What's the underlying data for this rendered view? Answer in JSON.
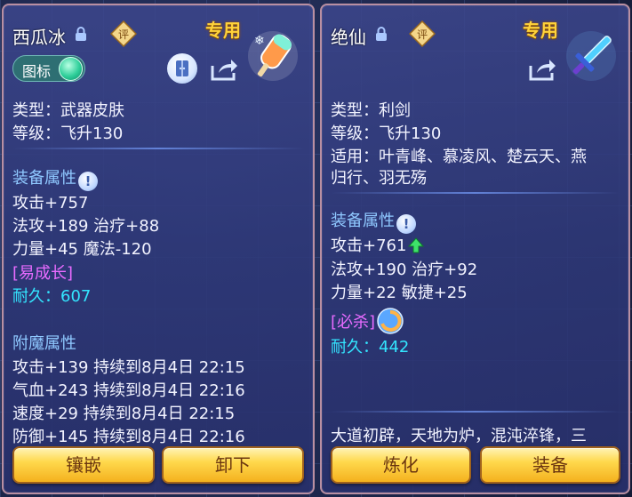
{
  "left_panel": {
    "name": "西瓜冰",
    "special_tag": "专用",
    "icon_toggle_label": "图标",
    "type_line": "类型：武器皮肤",
    "level_line": "等级：飞升130",
    "equip_attr_title": "装备属性",
    "attr_lines": [
      "攻击+757",
      "法攻+189 治疗+88",
      "力量+45 魔法-120"
    ],
    "growth_tag": "[易成长]",
    "durability": "耐久：607",
    "enchant_title": "附魔属性",
    "enchant_lines": [
      "攻击+139 持续到8月4日 22:15",
      "气血+243 持续到8月4日 22:16",
      "速度+29 持续到8月4日 22:15",
      "防御+145 持续到8月4日 22:16"
    ],
    "buttons": [
      "镶嵌",
      "卸下"
    ]
  },
  "right_panel": {
    "name": "绝仙",
    "special_tag": "专用",
    "type_line": "类型：利剑",
    "level_line": "等级：飞升130",
    "fit_line1": "适用：叶青峰、慕凌风、楚云天、燕",
    "fit_line2": "归行、羽无殇",
    "equip_attr_title": "装备属性",
    "attack_line": "攻击+761",
    "attr_lines": [
      "法攻+190 治疗+92",
      "力量+22 敏捷+25"
    ],
    "crit_tag": "[必杀]",
    "durability": "耐久：442",
    "lore": "大道初辟，天地为炉，混沌淬锋，三",
    "buttons": [
      "炼化",
      "装备"
    ]
  },
  "colors": {
    "gold_tag": "#ffd23a",
    "section_blue": "#8fc8ff",
    "cyan_value": "#33e6ff",
    "purple_tag": "#e86bff",
    "button_gold": "#ffd94d",
    "button_text": "#6b3610"
  },
  "icons": {
    "lock": "lock-icon",
    "rate": "rate-icon",
    "share": "share-icon",
    "info": "info-icon",
    "up": "up-arrow-icon",
    "skill": "skill-swirl-icon"
  }
}
